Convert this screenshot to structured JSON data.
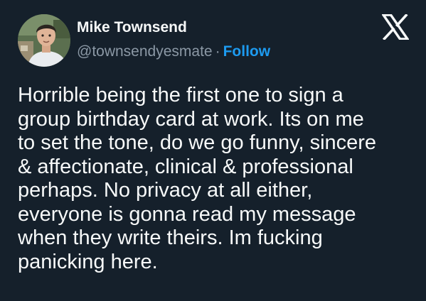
{
  "author": {
    "display_name": "Mike Townsend",
    "handle": "@townsendyesmate",
    "separator": "·",
    "follow_label": "Follow",
    "avatar_icon": "profile-photo"
  },
  "platform": {
    "logo_icon": "x-logo-icon"
  },
  "tweet": {
    "lines": [
      "Horrible being the first one to sign a",
      "group birthday card at work. Its on me",
      "to set the tone, do we go funny, sincere",
      "& affectionate, clinical & professional",
      "perhaps. No privacy at all either,",
      "everyone is gonna read my message",
      "when they write theirs. Im fucking",
      "panicking here."
    ]
  },
  "colors": {
    "background": "#15202b",
    "text": "#f7f9f9",
    "secondary_text": "#8b98a5",
    "accent": "#1d9bf0"
  }
}
